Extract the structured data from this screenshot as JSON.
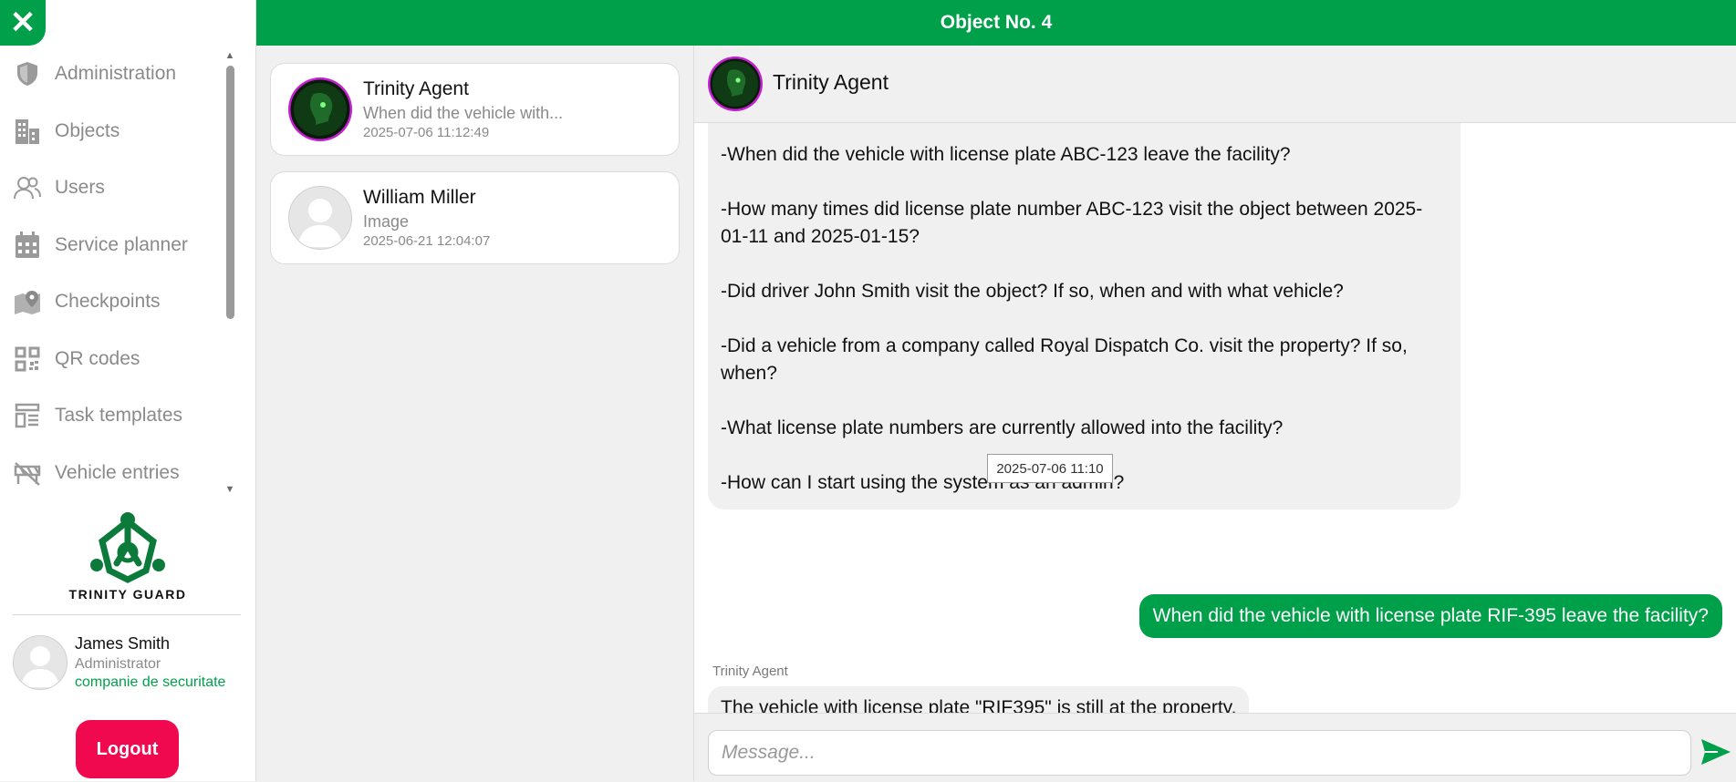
{
  "header": {
    "title": "Object No. 4"
  },
  "sidebar": {
    "close_icon": "close-icon",
    "items": [
      {
        "label": "Administration",
        "icon": "shield-icon"
      },
      {
        "label": "Objects",
        "icon": "building-icon"
      },
      {
        "label": "Users",
        "icon": "users-icon"
      },
      {
        "label": "Service planner",
        "icon": "calendar-icon"
      },
      {
        "label": "Checkpoints",
        "icon": "map-pin-icon"
      },
      {
        "label": "QR codes",
        "icon": "qr-code-icon"
      },
      {
        "label": "Task templates",
        "icon": "template-icon"
      },
      {
        "label": "Vehicle entries",
        "icon": "barrier-icon"
      }
    ],
    "logo_text": "TRINITY GUARD",
    "user": {
      "name": "James Smith",
      "role": "Administrator",
      "company": "companie de securitate"
    },
    "logout_label": "Logout"
  },
  "conversations": [
    {
      "name": "Trinity Agent",
      "preview": "When did the vehicle with...",
      "time": "2025-07-06 11:12:49"
    },
    {
      "name": "William Miller",
      "preview": "Image",
      "time": "2025-06-21 12:04:07"
    }
  ],
  "chat": {
    "contact_name": "Trinity Agent",
    "bot_message_lines": [
      "-When did the vehicle with license plate ABC-123 leave the facility?",
      "-How many times did license plate number ABC-123 visit the object between 2025-01-11 and 2025-01-15?",
      "-Did driver John Smith visit the object? If so, when and with what vehicle?",
      "-Did a vehicle from a company called Royal Dispatch Co. visit the property? If so, when?",
      "-What license plate numbers are currently allowed into the facility?",
      "-How can I start using the system as an admin?"
    ],
    "tooltip": "2025-07-06 11:10",
    "user_message": "When did the vehicle with license plate RIF-395 leave the facility?",
    "reply_sender": "Trinity Agent",
    "bot_reply": "The vehicle with license plate \"RIF395\" is still at the property.",
    "input_placeholder": "Message...",
    "send_icon": "send-icon"
  },
  "colors": {
    "brand": "#00a04a",
    "logout": "#f0094f",
    "muted_text": "#8a8a8a"
  }
}
